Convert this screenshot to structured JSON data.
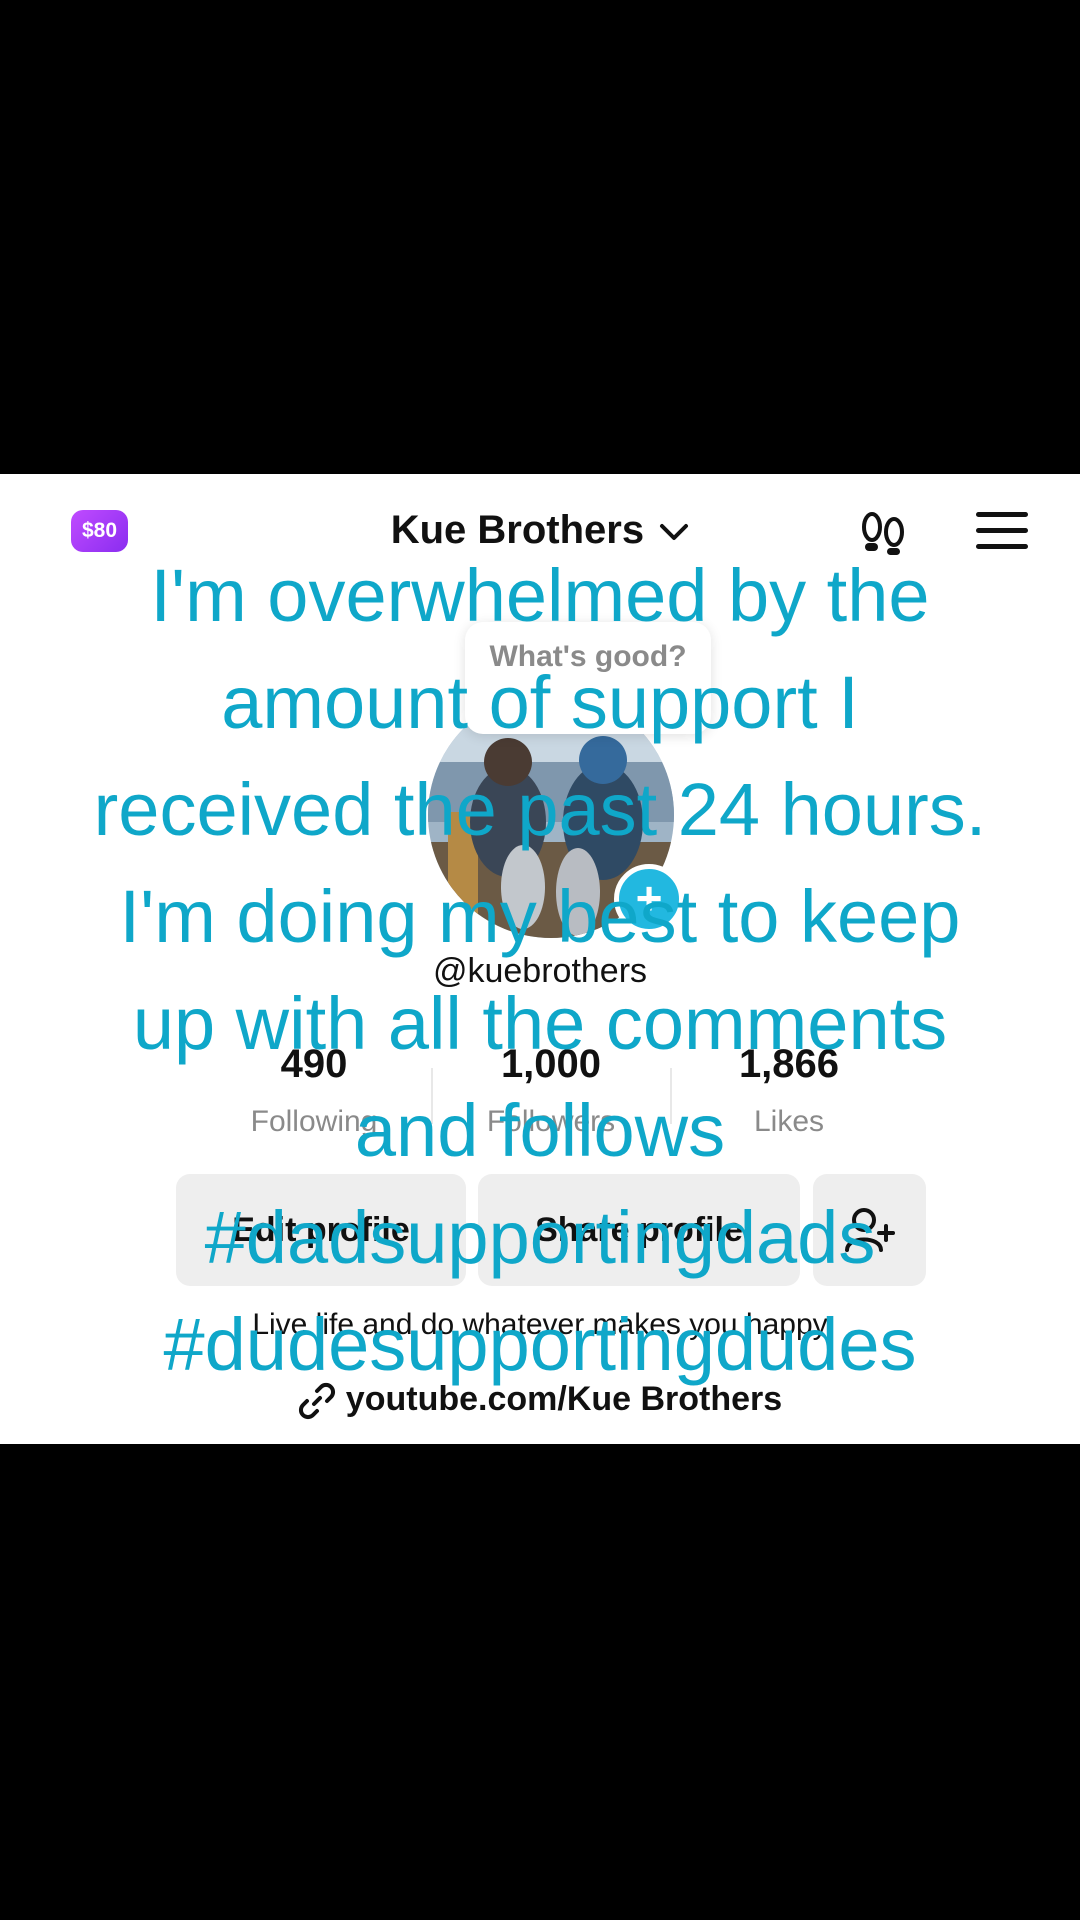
{
  "header": {
    "reward_badge": "$80",
    "profile_name": "Kue Brothers"
  },
  "profile_note": "What's good?",
  "profile": {
    "handle": "@kuebrothers",
    "stats": [
      {
        "value": "490",
        "label": "Following"
      },
      {
        "value": "1,000",
        "label": "Followers"
      },
      {
        "value": "1,866",
        "label": "Likes"
      }
    ],
    "edit_button": "Edit profile",
    "share_button": "Share profile",
    "bio": "Live life and do whatever makes you happy",
    "link": "youtube.com/Kue Brothers"
  },
  "overlay_caption": {
    "lines": [
      "I'm overwhelmed by the",
      "amount of support I",
      "received the past 24 hours.",
      "I'm doing my best to keep",
      "up with all the comments",
      "and follows",
      "#dadsupportingdads",
      "#dudesupportingdudes"
    ]
  },
  "colors": {
    "caption": "#0fa7c9",
    "badge_gradient_start": "#c04bff",
    "badge_gradient_end": "#8a2df0",
    "add_button": "#22b8e0"
  }
}
